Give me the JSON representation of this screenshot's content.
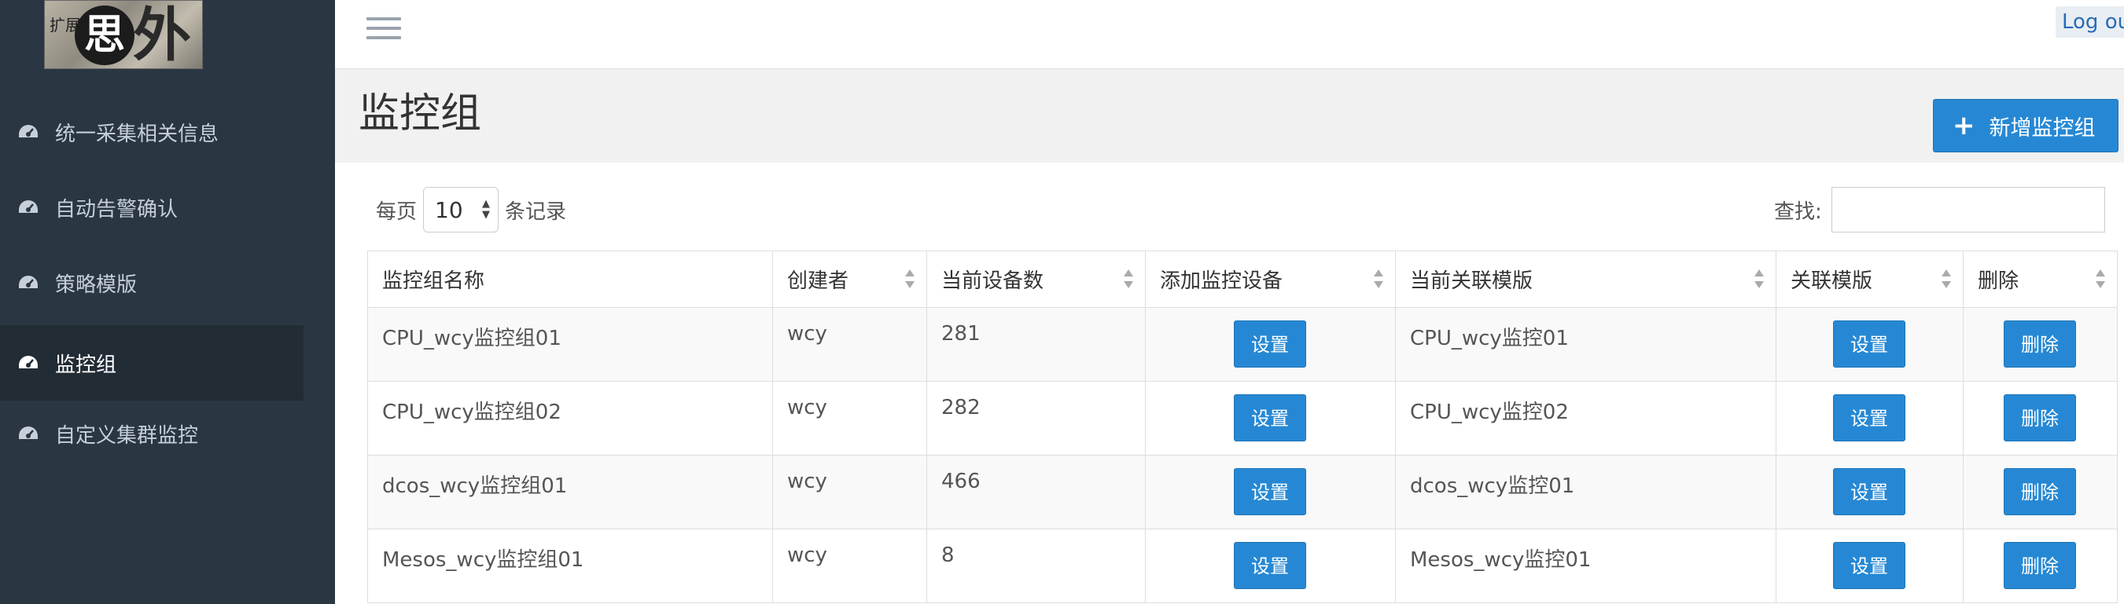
{
  "logo": {
    "main_glyph": "思",
    "side_glyph": "外",
    "small_text": "扩展"
  },
  "sidebar": {
    "items": [
      {
        "label": "统一采集相关信息",
        "icon": "dashboard-icon"
      },
      {
        "label": "自动告警确认",
        "icon": "dashboard-icon"
      },
      {
        "label": "策略模版",
        "icon": "dashboard-icon"
      },
      {
        "label": "监控组",
        "icon": "dashboard-icon",
        "active": true
      },
      {
        "label": "自定义集群监控",
        "icon": "dashboard-icon"
      }
    ]
  },
  "topbar": {
    "logout_label": "Log ou"
  },
  "page": {
    "title": "监控组",
    "add_button_label": "新增监控组"
  },
  "table_controls": {
    "length_prefix": "每页",
    "length_value": "10",
    "length_suffix": "条记录",
    "search_label": "查找:"
  },
  "table": {
    "columns": [
      "监控组名称",
      "创建者",
      "当前设备数",
      "添加监控设备",
      "当前关联模版",
      "关联模版",
      "删除"
    ],
    "rows": [
      {
        "name": "CPU_wcy监控组01",
        "creator": "wcy",
        "device_count": "281",
        "add_device": "设置",
        "template": "CPU_wcy监控01",
        "link_template": "设置",
        "delete": "删除"
      },
      {
        "name": "CPU_wcy监控组02",
        "creator": "wcy",
        "device_count": "282",
        "add_device": "设置",
        "template": "CPU_wcy监控02",
        "link_template": "设置",
        "delete": "删除"
      },
      {
        "name": "dcos_wcy监控组01",
        "creator": "wcy",
        "device_count": "466",
        "add_device": "设置",
        "template": "dcos_wcy监控01",
        "link_template": "设置",
        "delete": "删除"
      },
      {
        "name": "Mesos_wcy监控组01",
        "creator": "wcy",
        "device_count": "8",
        "add_device": "设置",
        "template": "Mesos_wcy监控01",
        "link_template": "设置",
        "delete": "删除"
      }
    ]
  },
  "colors": {
    "sidebar_bg": "#2b3643",
    "sidebar_active_bg": "#222c35",
    "primary": "#2688d4"
  }
}
